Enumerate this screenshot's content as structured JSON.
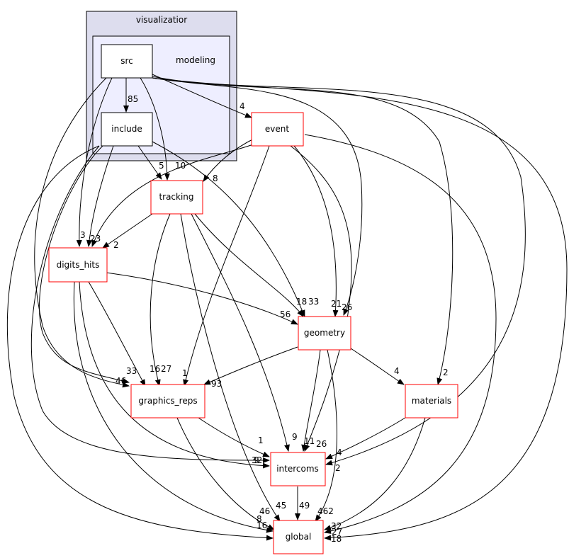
{
  "clusters": {
    "outer": {
      "label": "visualizatior",
      "fill": "#ddddee",
      "stroke": "#000000"
    },
    "inner": {
      "label": "modeling",
      "fill": "#eeeeff",
      "stroke": "#000000"
    }
  },
  "nodes": [
    {
      "id": "src",
      "label": "src",
      "border": "#000000"
    },
    {
      "id": "include",
      "label": "include",
      "border": "#000000"
    },
    {
      "id": "event",
      "label": "event",
      "border": "#ff0000"
    },
    {
      "id": "tracking",
      "label": "tracking",
      "border": "#ff0000"
    },
    {
      "id": "digits_hits",
      "label": "digits_hits",
      "border": "#ff0000"
    },
    {
      "id": "geometry",
      "label": "geometry",
      "border": "#ff0000"
    },
    {
      "id": "graphics_reps",
      "label": "graphics_reps",
      "border": "#ff0000"
    },
    {
      "id": "materials",
      "label": "materials",
      "border": "#ff0000"
    },
    {
      "id": "intercoms",
      "label": "intercoms",
      "border": "#ff0000"
    },
    {
      "id": "global",
      "label": "global",
      "border": "#ff0000"
    }
  ],
  "edges": [
    {
      "from": "src",
      "to": "include",
      "label": "85"
    },
    {
      "from": "src",
      "to": "event",
      "label": "4"
    },
    {
      "from": "src",
      "to": "tracking",
      "label": "10"
    },
    {
      "from": "src",
      "to": "digits_hits",
      "label": "3"
    },
    {
      "from": "src",
      "to": "graphics_reps",
      "label": "46"
    },
    {
      "from": "src",
      "to": "geometry",
      "label": "26"
    },
    {
      "from": "src",
      "to": "materials",
      "label": "2"
    },
    {
      "from": "src",
      "to": "intercoms",
      "label": "26"
    },
    {
      "from": "src",
      "to": "global",
      "label": "18"
    },
    {
      "from": "include",
      "to": "tracking",
      "label": "5"
    },
    {
      "from": "include",
      "to": "digits_hits",
      "label": "23"
    },
    {
      "from": "include",
      "to": "graphics_reps",
      "label": "33"
    },
    {
      "from": "include",
      "to": "geometry",
      "label": "33"
    },
    {
      "from": "include",
      "to": "intercoms",
      "label": "32"
    },
    {
      "from": "include",
      "to": "global",
      "label": "16"
    },
    {
      "from": "event",
      "to": "tracking",
      "label": "8"
    },
    {
      "from": "event",
      "to": "digits_hits",
      "label": "3"
    },
    {
      "from": "event",
      "to": "graphics_reps",
      "label": "1"
    },
    {
      "from": "event",
      "to": "geometry",
      "label": "21"
    },
    {
      "from": "event",
      "to": "intercoms",
      "label": "11"
    },
    {
      "from": "event",
      "to": "global",
      "label": "27"
    },
    {
      "from": "tracking",
      "to": "digits_hits",
      "label": "2"
    },
    {
      "from": "tracking",
      "to": "graphics_reps",
      "label": "27"
    },
    {
      "from": "tracking",
      "to": "geometry",
      "label": "18"
    },
    {
      "from": "tracking",
      "to": "intercoms",
      "label": "9"
    },
    {
      "from": "tracking",
      "to": "global",
      "label": "45"
    },
    {
      "from": "digits_hits",
      "to": "geometry",
      "label": "56"
    },
    {
      "from": "digits_hits",
      "to": "graphics_reps",
      "label": "16"
    },
    {
      "from": "digits_hits",
      "to": "intercoms",
      "label": "9"
    },
    {
      "from": "digits_hits",
      "to": "global",
      "label": "46"
    },
    {
      "from": "geometry",
      "to": "graphics_reps",
      "label": "93"
    },
    {
      "from": "geometry",
      "to": "materials",
      "label": "4"
    },
    {
      "from": "geometry",
      "to": "intercoms",
      "label": "11"
    },
    {
      "from": "geometry",
      "to": "global",
      "label": "462"
    },
    {
      "from": "graphics_reps",
      "to": "intercoms",
      "label": "1"
    },
    {
      "from": "graphics_reps",
      "to": "global",
      "label": "8"
    },
    {
      "from": "materials",
      "to": "intercoms",
      "label": "4"
    },
    {
      "from": "materials",
      "to": "global",
      "label": "32"
    },
    {
      "from": "intercoms",
      "to": "global",
      "label": "49"
    },
    {
      "from": "include",
      "to": "intercoms",
      "label": "2"
    }
  ]
}
